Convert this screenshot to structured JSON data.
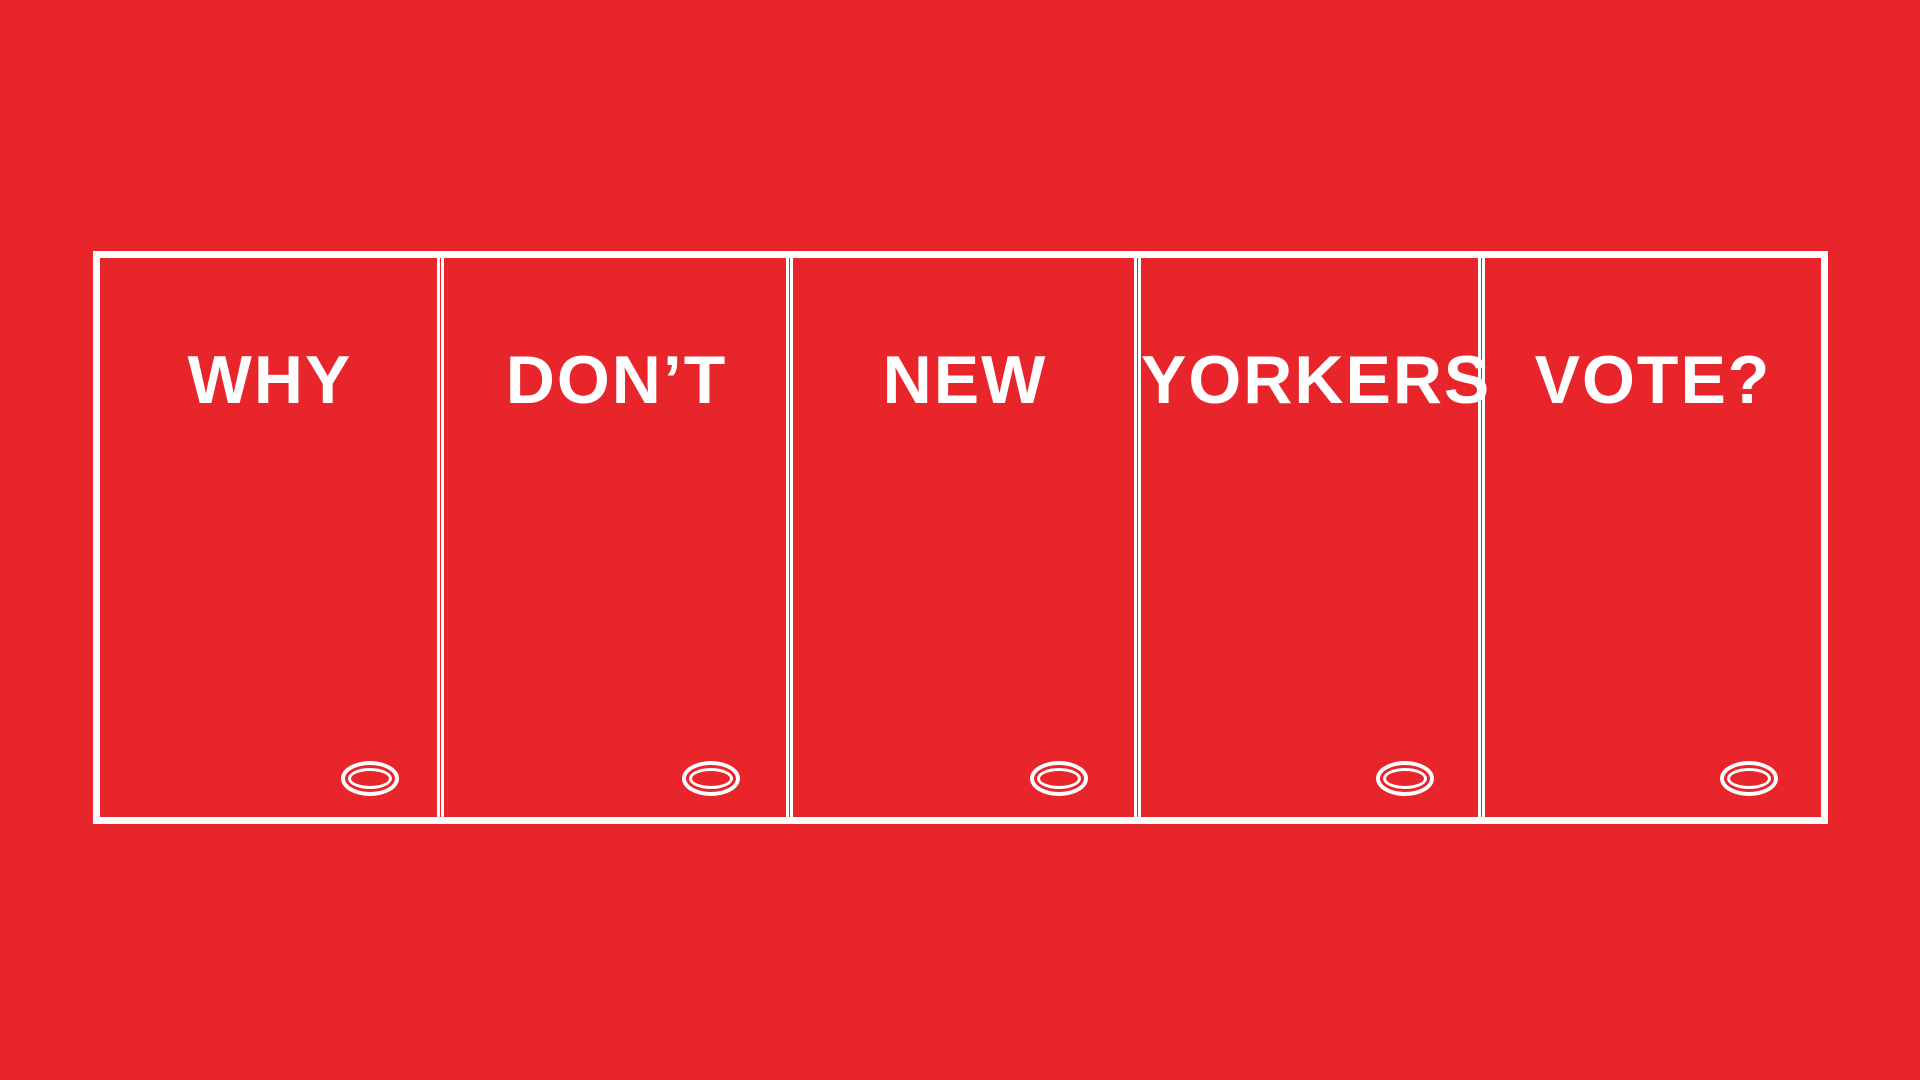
{
  "ballot": {
    "cells": [
      {
        "word": "WHY"
      },
      {
        "word": "DON’T"
      },
      {
        "word": "NEW"
      },
      {
        "word": "YORKERS"
      },
      {
        "word": "VOTE?"
      }
    ]
  },
  "colors": {
    "background": "#e8252b",
    "foreground": "#ffffff"
  }
}
